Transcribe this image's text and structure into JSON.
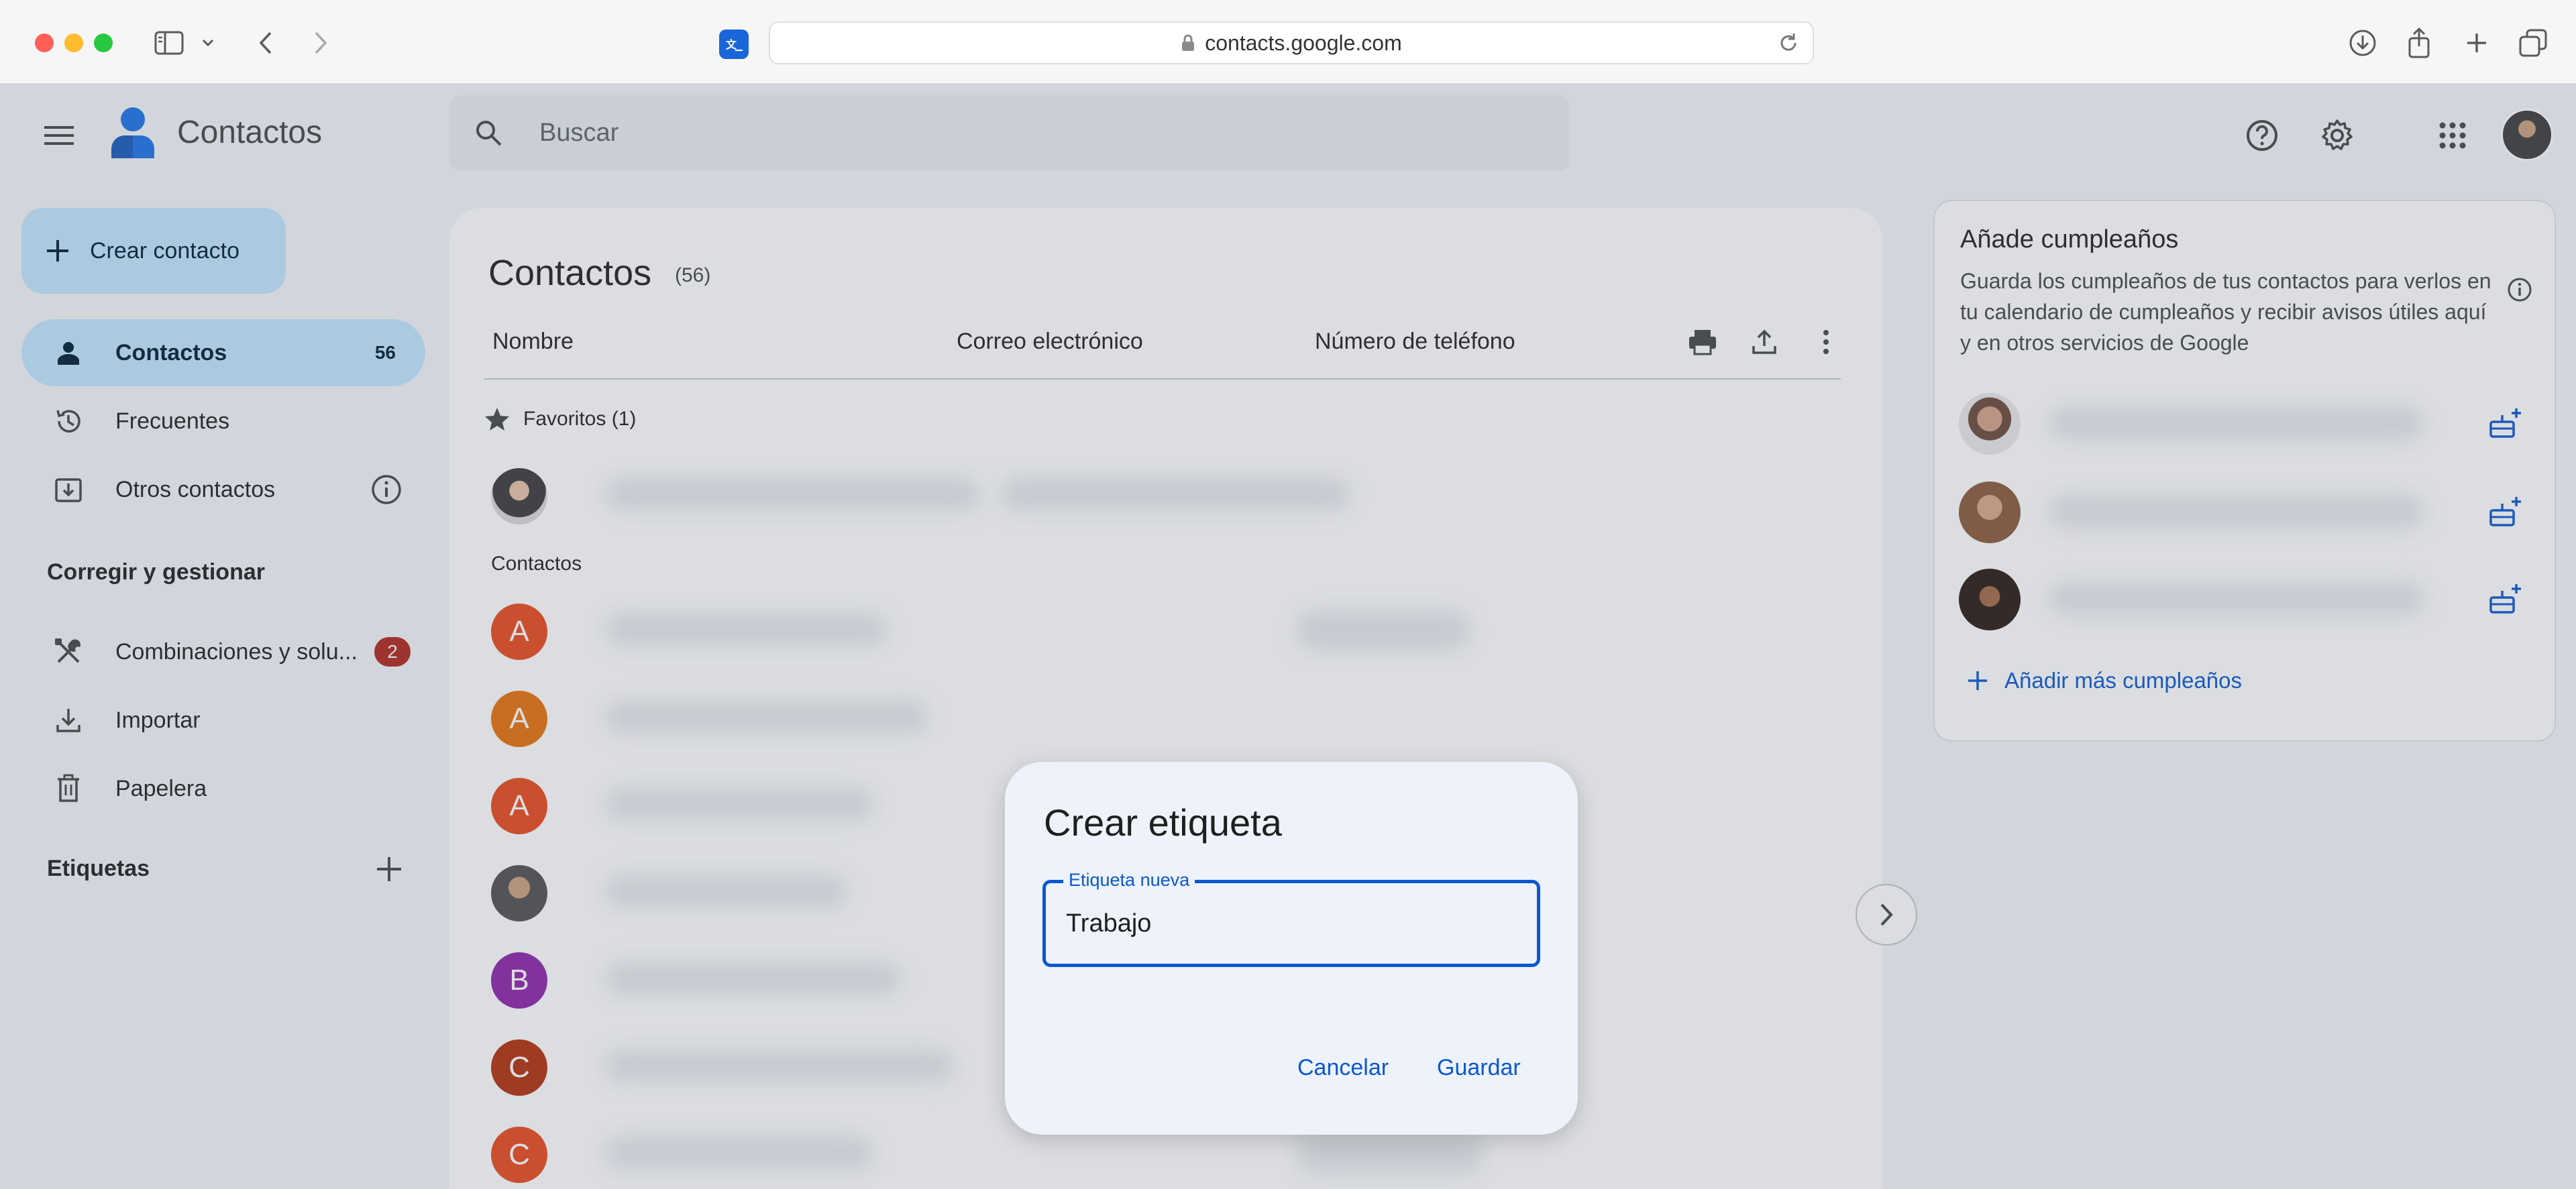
{
  "browser": {
    "url": "contacts.google.com"
  },
  "app": {
    "title": "Contactos",
    "search_placeholder": "Buscar"
  },
  "sidebar": {
    "create_label": "Crear contacto",
    "nav": [
      {
        "label": "Contactos",
        "count": "56"
      },
      {
        "label": "Frecuentes"
      },
      {
        "label": "Otros contactos"
      }
    ],
    "manage_heading": "Corregir y gestionar",
    "manage": [
      {
        "label": "Combinaciones y solu...",
        "badge": "2"
      },
      {
        "label": "Importar"
      },
      {
        "label": "Papelera"
      }
    ],
    "labels_heading": "Etiquetas"
  },
  "main": {
    "title": "Contactos",
    "count": "(56)",
    "columns": [
      "Nombre",
      "Correo electrónico",
      "Número de teléfono"
    ],
    "favorites_label": "Favoritos (1)",
    "contacts_label": "Contactos",
    "contacts": [
      {
        "initial": "A",
        "color": "#e8491d"
      },
      {
        "initial": "A",
        "color": "#e8710a"
      },
      {
        "initial": "A",
        "color": "#e8491d"
      },
      {
        "initial": "",
        "color": "#8a8a8a"
      },
      {
        "initial": "B",
        "color": "#8e24aa"
      },
      {
        "initial": "C",
        "color": "#b3300e"
      },
      {
        "initial": "C",
        "color": "#e8491d"
      }
    ]
  },
  "birthday_card": {
    "title": "Añade cumpleaños",
    "description": "Guarda los cumpleaños de tus contactos para verlos en tu calendario de cumpleaños y recibir avisos útiles aquí y en otros servicios de Google",
    "more_label": "Añadir más cumpleaños"
  },
  "dialog": {
    "title": "Crear etiqueta",
    "field_label": "Etiqueta nueva",
    "field_value": "Trabajo",
    "cancel_label": "Cancelar",
    "save_label": "Guardar"
  },
  "colors": {
    "accent": "#0b57d0",
    "active_nav": "#c2e7ff",
    "badge": "#b3261e"
  }
}
